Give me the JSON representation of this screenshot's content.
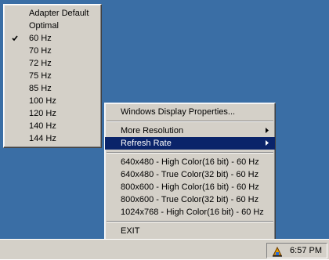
{
  "refresh_menu": {
    "items": [
      {
        "label": "Adapter Default",
        "checked": false
      },
      {
        "label": "Optimal",
        "checked": false
      },
      {
        "label": "60 Hz",
        "checked": true
      },
      {
        "label": "70 Hz",
        "checked": false
      },
      {
        "label": "72 Hz",
        "checked": false
      },
      {
        "label": "75 Hz",
        "checked": false
      },
      {
        "label": "85 Hz",
        "checked": false
      },
      {
        "label": "100 Hz",
        "checked": false
      },
      {
        "label": "120 Hz",
        "checked": false
      },
      {
        "label": "140 Hz",
        "checked": false
      },
      {
        "label": "144 Hz",
        "checked": false
      }
    ]
  },
  "main_menu": {
    "display_properties": "Windows Display Properties...",
    "more_resolution": "More Resolution",
    "refresh_rate": "Refresh Rate",
    "modes": [
      "640x480 - High Color(16 bit) - 60 Hz",
      "640x480 - True Color(32 bit) - 60 Hz",
      "800x600 - High Color(16 bit) - 60 Hz",
      "800x600 - True Color(32 bit) - 60 Hz",
      "1024x768 - High Color(16 bit) - 60 Hz"
    ],
    "exit": "EXIT"
  },
  "taskbar": {
    "clock": "6:57 PM",
    "tray_icon": "display-settings-tray-icon"
  },
  "colors": {
    "menu_bg": "#d4d0c8",
    "highlight": "#0a246a",
    "desktop": "#3a6ea5"
  }
}
